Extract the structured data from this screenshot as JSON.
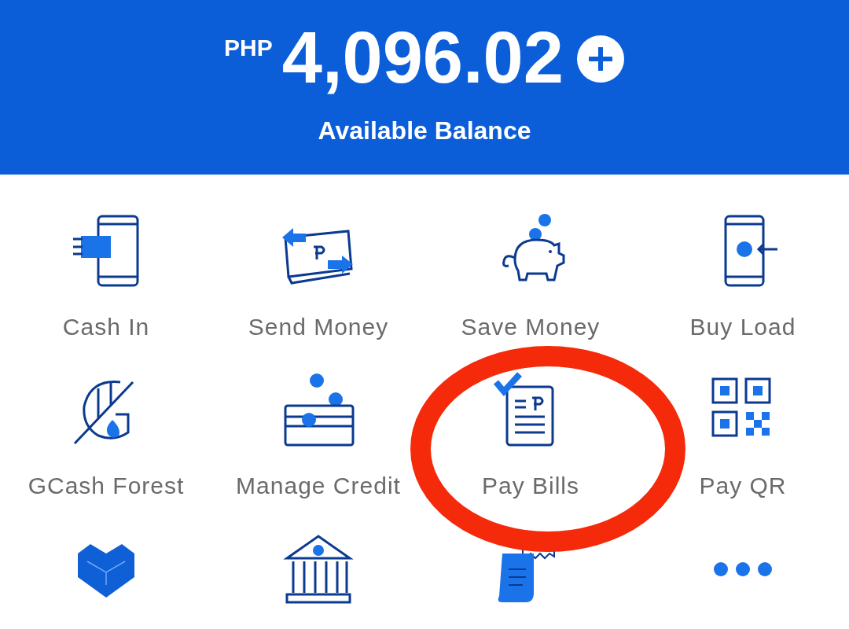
{
  "balance": {
    "currency": "PHP",
    "amount": "4,096.02",
    "caption": "Available Balance"
  },
  "services": [
    {
      "label": "Cash In"
    },
    {
      "label": "Send Money"
    },
    {
      "label": "Save Money"
    },
    {
      "label": "Buy Load"
    },
    {
      "label": "GCash Forest"
    },
    {
      "label": "Manage Credit"
    },
    {
      "label": "Pay Bills"
    },
    {
      "label": "Pay QR"
    }
  ]
}
